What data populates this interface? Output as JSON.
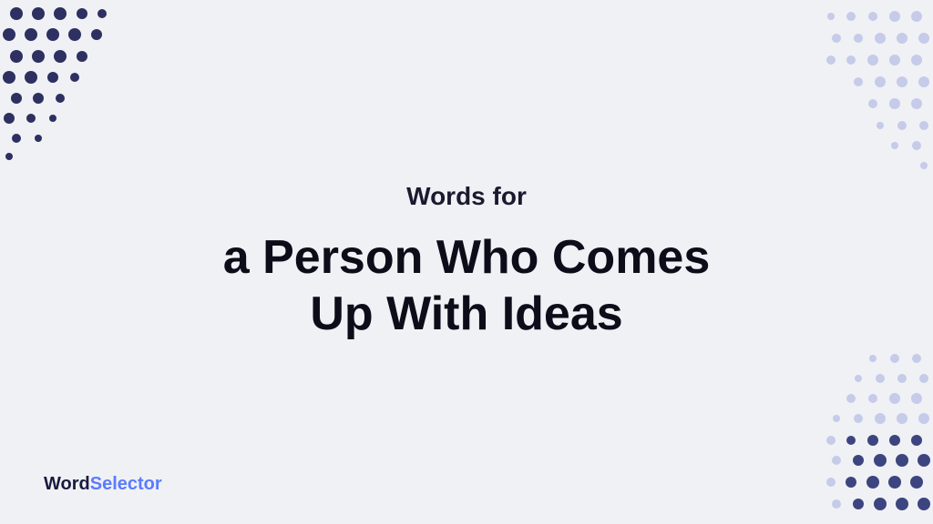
{
  "page": {
    "background_color": "#f0f1f5",
    "subtitle": "Words for",
    "main_title_line1": "a Person Who Comes",
    "main_title_line2": "Up With Ideas",
    "logo": {
      "word_part": "Word",
      "selector_part": "Selector"
    }
  },
  "dots": {
    "top_left_color": "#2d3060",
    "top_right_color": "#c5cbe8",
    "bottom_right_dark_color": "#3d4580",
    "bottom_right_light_color": "#c5cbe8"
  }
}
